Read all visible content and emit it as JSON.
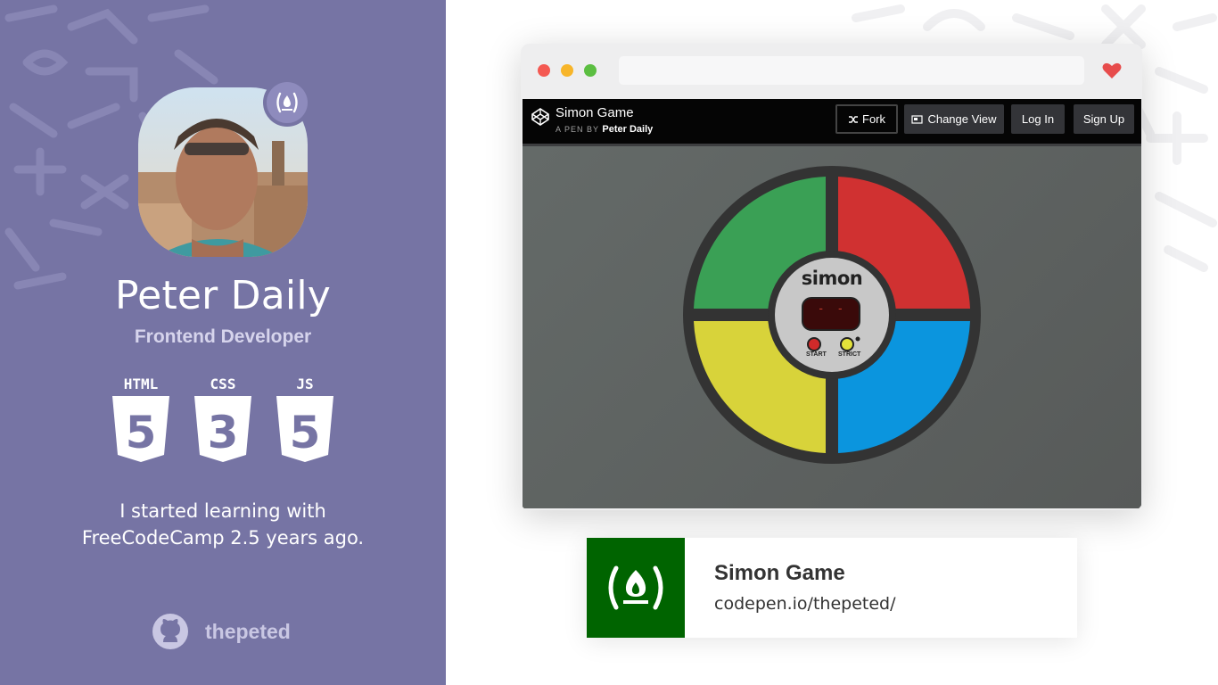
{
  "profile": {
    "name": "Peter Daily",
    "role": "Frontend Developer",
    "badges": [
      "HTML",
      "CSS",
      "JS"
    ],
    "badge_numbers": [
      "5",
      "3",
      "5"
    ],
    "bio_line1": "I started learning with",
    "bio_line2": "FreeCodeCamp 2.5 years ago.",
    "github_user": "thepeted"
  },
  "browser": {
    "dot_colors": [
      "#f45952",
      "#f7b52a",
      "#5bbe41"
    ],
    "heart_color": "#e74c4c"
  },
  "codepen": {
    "title": "Simon Game",
    "by_prefix": "A PEN BY",
    "author": "Peter Daily",
    "buttons": {
      "fork": "Fork",
      "change_view": "Change View",
      "login": "Log In",
      "signup": "Sign Up"
    }
  },
  "simon": {
    "brand": "simon",
    "count": "- -",
    "start_label": "START",
    "strict_label": "STRICT",
    "colors": {
      "green": "#3aa055",
      "red": "#d03131",
      "yellow": "#d8d33a",
      "blue": "#0b95de"
    }
  },
  "card": {
    "title": "Simon Game",
    "url": "codepen.io/thepeted/",
    "bg": "#006400"
  },
  "colors": {
    "panel": "#7674a4",
    "accent": "#006400"
  }
}
